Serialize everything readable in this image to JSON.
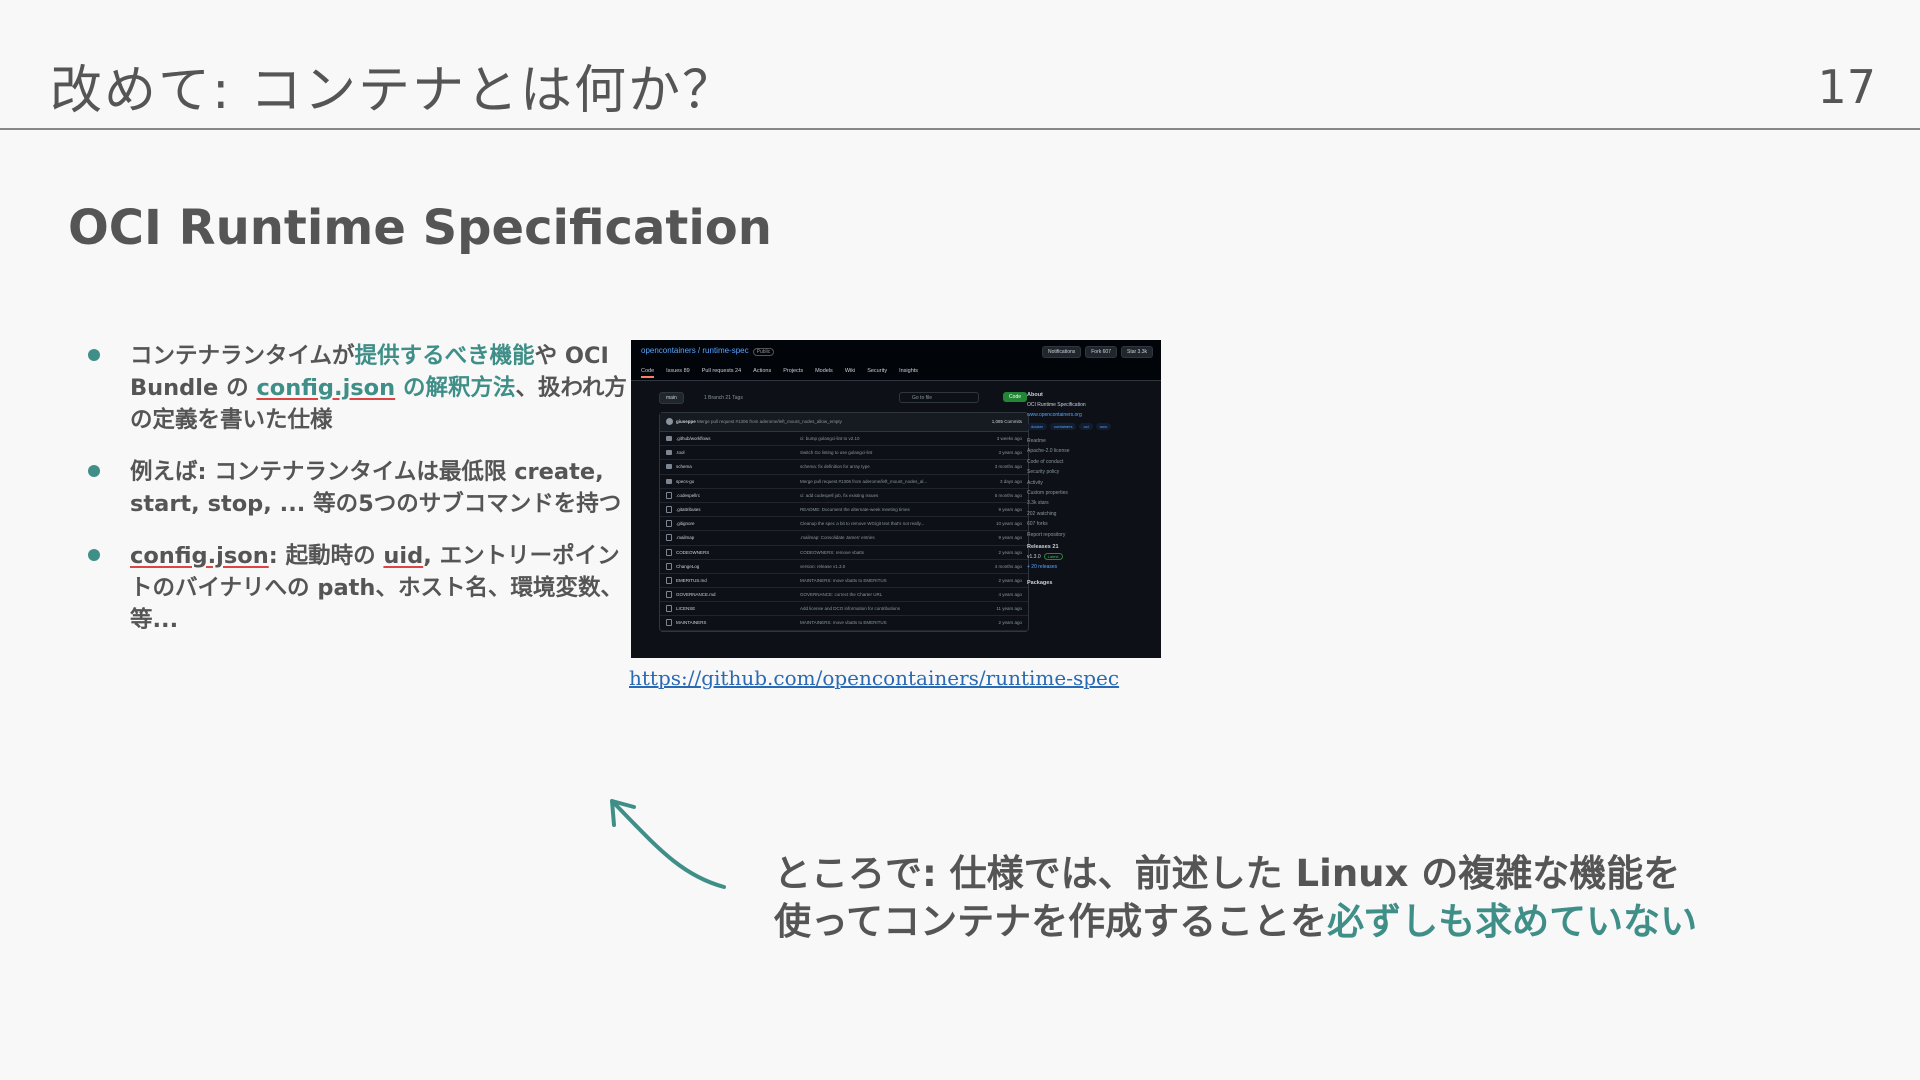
{
  "header": {
    "title": "改めて: コンテナとは何か？",
    "page_number": "17"
  },
  "section_title": "OCI Runtime Specification",
  "bullets": [
    {
      "t1": "コンテナランタイムが",
      "t2": "提供するべき機能",
      "t3": "や OCI Bundle の ",
      "t4": "config.json",
      "t5": " の解釈方法",
      "t6": "、扱われ方の定義を書いた仕様"
    },
    {
      "t1": "例えば: コンテナランタイムは最低限 create, start, stop, ... 等の5つのサブコマンドを持つ"
    },
    {
      "t1": "config.json",
      "t2": ": 起動時の ",
      "t3": "uid",
      "t4": ", エントリーポイントのバイナリへの path、ホスト名、環境変数、等..."
    }
  ],
  "github_screenshot": {
    "repo": "opencontainers / runtime-spec",
    "visibility": "Public",
    "actions": [
      "Notifications",
      "Fork 607",
      "Star 3.3k"
    ],
    "tabs": [
      "Code",
      "Issues 89",
      "Pull requests 24",
      "Actions",
      "Projects",
      "Models",
      "Wiki",
      "Security",
      "Insights"
    ],
    "branch": "main",
    "branch_info": "1 Branch  21 Tags",
    "goto_placeholder": "Go to file",
    "code_button": "Code",
    "commit": {
      "author": "giuseppe",
      "message": "Merge pull request #1306 from aderome/left_mount_nodes_allow_empty",
      "count": "1,085 Commits"
    },
    "files": [
      {
        "name": ".github/workflows",
        "type": "dir",
        "msg": "ci: bump golangci-lint to v2.10",
        "time": "3 weeks ago"
      },
      {
        "name": ".tool",
        "type": "dir",
        "msg": "Switch Go linting to use golangci-lint",
        "time": "3 years ago"
      },
      {
        "name": "schema",
        "type": "dir",
        "msg": "schema: fix definition for array type",
        "time": "3 months ago"
      },
      {
        "name": "specs-go",
        "type": "dir",
        "msg": "Merge pull request #1306 from aderome/left_mount_nodes_al...",
        "time": "3 days ago"
      },
      {
        "name": ".codespellrc",
        "type": "file",
        "msg": "ci: add codespell job, fix existing issues",
        "time": "5 months ago"
      },
      {
        "name": ".gitattributes",
        "type": "file",
        "msg": "README: Document the alternate-week meeting times",
        "time": "9 years ago"
      },
      {
        "name": ".gitignore",
        "type": "file",
        "msg": "Cleanup the spec a bit to remove WG/git text that's not really...",
        "time": "10 years ago"
      },
      {
        "name": ".mailmap",
        "type": "file",
        "msg": ".mailmap: Consolidate James' entries",
        "time": "9 years ago"
      },
      {
        "name": "CODEOWNERS",
        "type": "file",
        "msg": "CODEOWNERS: remove vbatts",
        "time": "2 years ago"
      },
      {
        "name": "ChangeLog",
        "type": "file",
        "msg": "version: release v1.3.0",
        "time": "4 months ago"
      },
      {
        "name": "EMERITUS.md",
        "type": "file",
        "msg": "MAINTAINERS: move vbatts to EMERITUS",
        "time": "2 years ago"
      },
      {
        "name": "GOVERNANCE.md",
        "type": "file",
        "msg": "GOVERNANCE: correct the Charter URL",
        "time": "4 years ago"
      },
      {
        "name": "LICENSE",
        "type": "file",
        "msg": "Add license and DCO information for contributions",
        "time": "11 years ago"
      },
      {
        "name": "MAINTAINERS",
        "type": "file",
        "msg": "MAINTAINERS: move vbatts to EMERITUS",
        "time": "2 years ago"
      }
    ],
    "about": {
      "heading": "About",
      "description": "OCI Runtime Specification",
      "website": "www.opencontainers.org",
      "topics": [
        "docker",
        "containers",
        "oci",
        "runc"
      ],
      "items": [
        "Readme",
        "Apache-2.0 license",
        "Code of conduct",
        "Security policy",
        "Activity",
        "Custom properties",
        "3.3k stars",
        "202 watching",
        "607 forks",
        "Report repository"
      ],
      "releases_heading": "Releases 21",
      "release": "v1.3.0",
      "latest": "Latest",
      "more_releases": "+ 20 releases",
      "packages_heading": "Packages"
    }
  },
  "link_text": "https://github.com/opencontainers/runtime-spec",
  "note": {
    "line1": "ところで: 仕様では、前述した Linux の複雑な機能を",
    "line2a": "使ってコンテナを作成することを",
    "line2b": "必ずしも求めていない"
  },
  "colors": {
    "accent": "#3f8f88",
    "text": "#555555",
    "link": "#2a6ab4",
    "background": "#f8f8f8"
  }
}
